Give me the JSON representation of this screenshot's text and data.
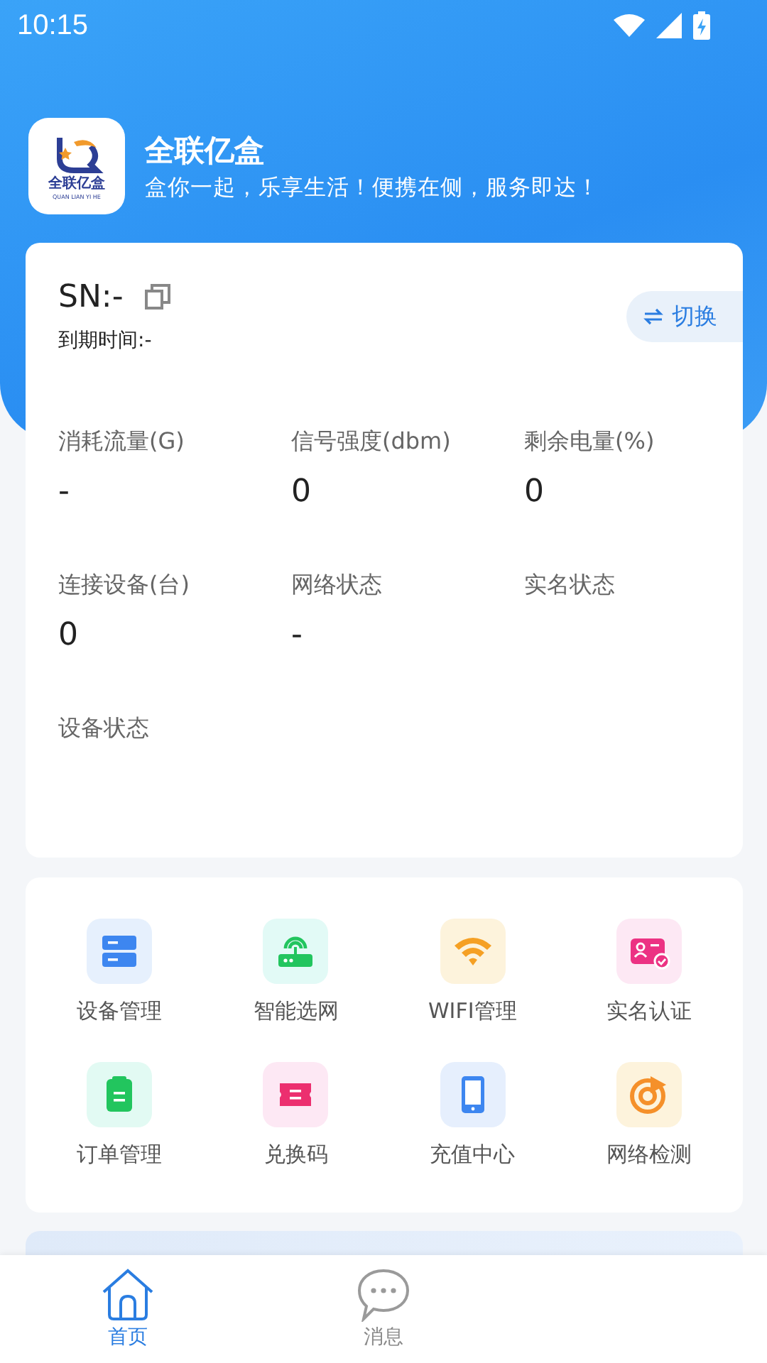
{
  "status_bar": {
    "time": "10:15"
  },
  "app": {
    "name": "全联亿盒",
    "slogan": "盒你一起，乐享生活！便携在侧，服务即达！",
    "logo_text": "全联亿盒",
    "logo_subtext": "QUAN LIAN YI HE"
  },
  "device": {
    "sn": "SN:-",
    "expiry": "到期时间:-",
    "switch_button": "切换"
  },
  "stats": [
    {
      "label": "消耗流量(G)",
      "value": "-"
    },
    {
      "label": "信号强度(dbm)",
      "value": "0"
    },
    {
      "label": "剩余电量(%)",
      "value": "0"
    },
    {
      "label": "连接设备(台)",
      "value": "0"
    },
    {
      "label": "网络状态",
      "value": "-"
    },
    {
      "label": "实名状态"
    },
    {
      "label": "设备状态"
    }
  ],
  "menu": [
    {
      "label": "设备管理"
    },
    {
      "label": "智能选网"
    },
    {
      "label": "WIFI管理"
    },
    {
      "label": "实名认证"
    },
    {
      "label": "订单管理"
    },
    {
      "label": "兑换码"
    },
    {
      "label": "充值中心"
    },
    {
      "label": "网络检测"
    }
  ],
  "tabs": [
    {
      "label": "首页",
      "selected": true
    },
    {
      "label": "消息",
      "selected": false
    }
  ]
}
